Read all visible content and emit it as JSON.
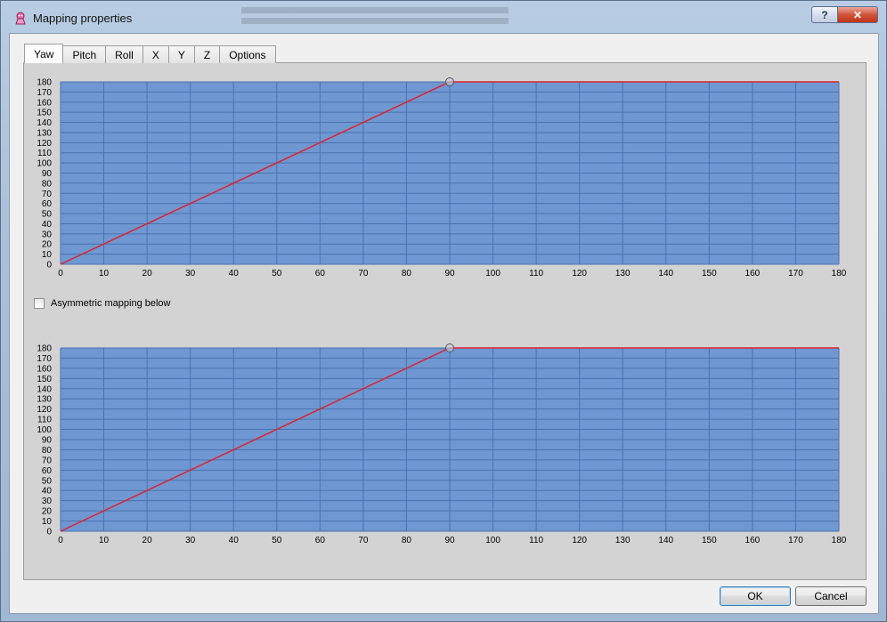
{
  "window": {
    "title": "Mapping properties",
    "help_label": "?",
    "close_label": "✕",
    "icon": "app-icon"
  },
  "tabs": [
    {
      "label": "Yaw",
      "active": true
    },
    {
      "label": "Pitch",
      "active": false
    },
    {
      "label": "Roll",
      "active": false
    },
    {
      "label": "X",
      "active": false
    },
    {
      "label": "Y",
      "active": false
    },
    {
      "label": "Z",
      "active": false
    },
    {
      "label": "Options",
      "active": false
    }
  ],
  "asymmetric": {
    "label": "Asymmetric mapping below",
    "checked": false
  },
  "buttons": {
    "ok": "OK",
    "cancel": "Cancel"
  },
  "colors": {
    "plot_bg": "#6f98d2",
    "grid": "#4a72b0",
    "curve": "#e0202a",
    "panel": "#d3d3d3"
  },
  "chart_data": [
    {
      "type": "line",
      "title": "",
      "xlabel": "",
      "ylabel": "",
      "xlim": [
        0,
        180
      ],
      "ylim": [
        0,
        180
      ],
      "x_ticks": [
        0,
        10,
        20,
        30,
        40,
        50,
        60,
        70,
        80,
        90,
        100,
        110,
        120,
        130,
        140,
        150,
        160,
        170,
        180
      ],
      "y_ticks": [
        0,
        10,
        20,
        30,
        40,
        50,
        60,
        70,
        80,
        90,
        100,
        110,
        120,
        130,
        140,
        150,
        160,
        170,
        180
      ],
      "grid": true,
      "series": [
        {
          "x": [
            0,
            90,
            180
          ],
          "y": [
            0,
            180,
            180
          ]
        }
      ],
      "control_points": [
        {
          "x": 90,
          "y": 180
        }
      ]
    },
    {
      "type": "line",
      "title": "",
      "xlabel": "",
      "ylabel": "",
      "xlim": [
        0,
        180
      ],
      "ylim": [
        0,
        180
      ],
      "x_ticks": [
        0,
        10,
        20,
        30,
        40,
        50,
        60,
        70,
        80,
        90,
        100,
        110,
        120,
        130,
        140,
        150,
        160,
        170,
        180
      ],
      "y_ticks": [
        0,
        10,
        20,
        30,
        40,
        50,
        60,
        70,
        80,
        90,
        100,
        110,
        120,
        130,
        140,
        150,
        160,
        170,
        180
      ],
      "grid": true,
      "series": [
        {
          "x": [
            0,
            90,
            180
          ],
          "y": [
            0,
            180,
            180
          ]
        }
      ],
      "control_points": [
        {
          "x": 90,
          "y": 180
        }
      ]
    }
  ]
}
